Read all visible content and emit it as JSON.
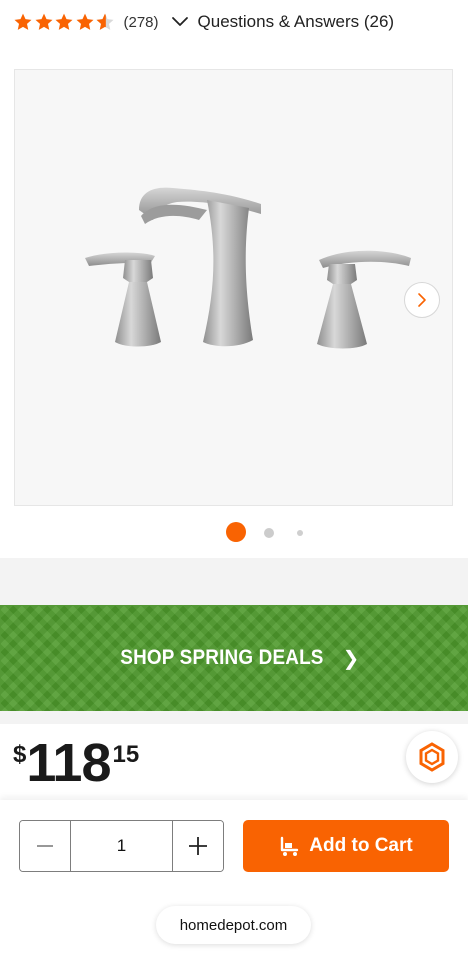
{
  "rating": {
    "stars_value": 4.5,
    "stars_max": 5,
    "count": "(278)",
    "qa_link": "Questions & Answers (26)"
  },
  "gallery": {
    "image_count": 3,
    "active_index": 0,
    "next_icon": "chevron-right-icon"
  },
  "promo": {
    "label": "SHOP SPRING DEALS",
    "chevron": "❯"
  },
  "price": {
    "symbol": "$",
    "whole": "118",
    "cents": "15"
  },
  "cart": {
    "minus_icon": "minus-icon",
    "quantity": "1",
    "plus_icon": "plus-icon",
    "add_label": "Add to Cart",
    "cart_icon": "cart-icon"
  },
  "browser": {
    "url": "homedepot.com"
  },
  "colors": {
    "brand_orange": "#f96302",
    "promo_green": "#4e9a2c",
    "star_orange": "#f96302"
  }
}
